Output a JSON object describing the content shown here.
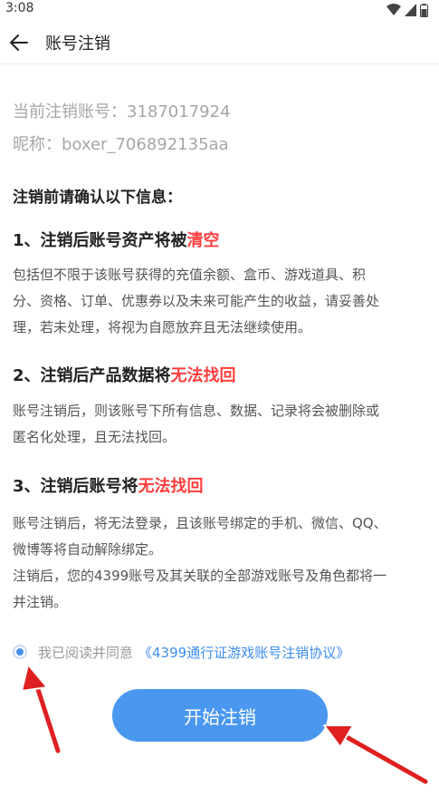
{
  "status_bar": {
    "time": "3:08"
  },
  "app_bar": {
    "title": "账号注销"
  },
  "account": {
    "id_line": "当前注销账号：3187017924",
    "nick_line": "昵称：boxer_706892135aa"
  },
  "confirm_heading": "注销前请确认以下信息：",
  "items": [
    {
      "title_prefix": "1、注销后账号资产将被",
      "title_highlight": "清空",
      "body": [
        "包括但不限于该账号获得的充值余额、盒币、游戏道具、积",
        "分、资格、订单、优惠券以及未来可能产生的收益，请妥善处",
        "理，若未处理，将视为自愿放弃且无法继续使用。"
      ]
    },
    {
      "title_prefix": "2、注销后产品数据将",
      "title_highlight": "无法找回",
      "body": [
        "账号注销后，则该账号下所有信息、数据、记录将会被删除或",
        "匿名化处理，且无法找回。"
      ]
    },
    {
      "title_prefix": "3、注销后账号将",
      "title_highlight": "无法找回",
      "body": [
        "账号注销后，将无法登录，且该账号绑定的手机、微信、QQ、",
        "微博等将自动解除绑定。",
        "注销后，您的4399账号及其关联的全部游戏账号及角色都将一",
        "并注销。"
      ]
    }
  ],
  "agreement": {
    "checked": true,
    "text": "我已阅读并同意",
    "link": "《4399通行证游戏账号注销协议》"
  },
  "start_button": {
    "label": "开始注销"
  },
  "colors": {
    "accent": "#4a97f0",
    "highlight": "#ff3d3d",
    "link": "#3d8df0",
    "annotation_arrow": "#e02020"
  }
}
